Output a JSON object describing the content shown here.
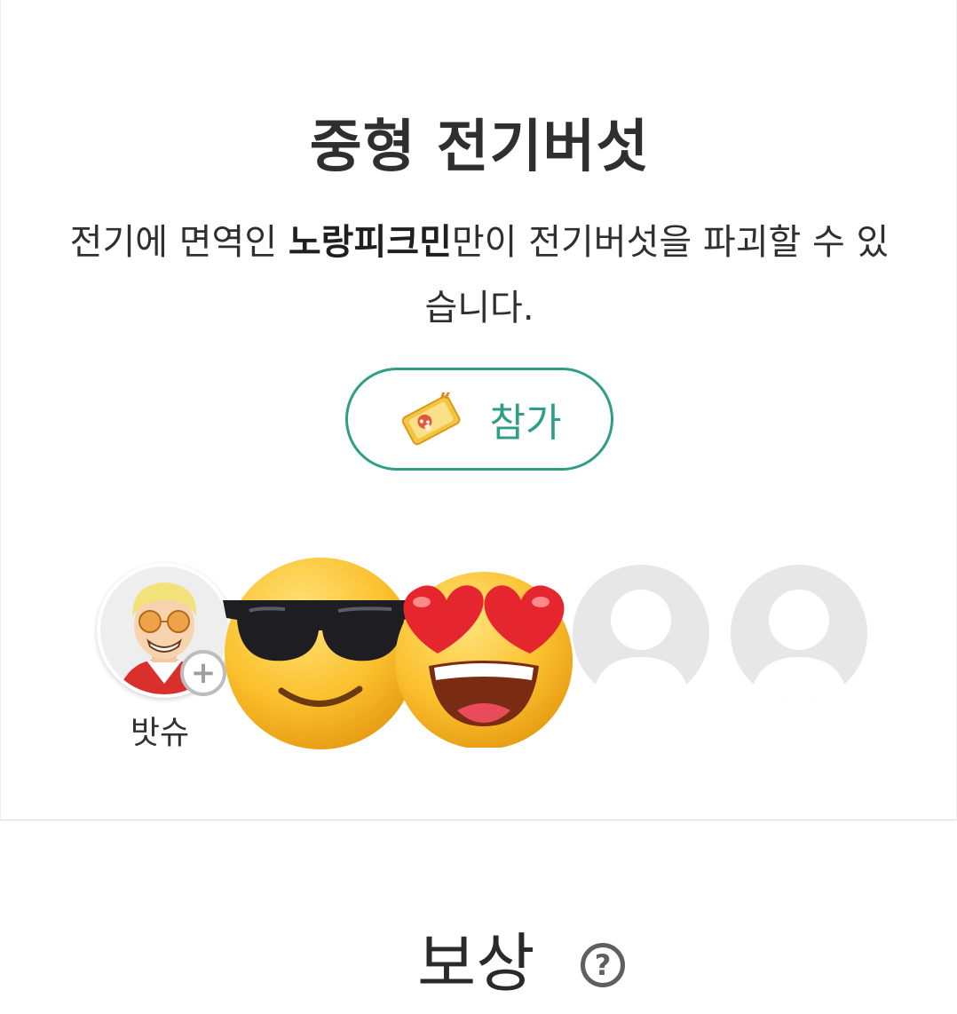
{
  "mission": {
    "title": "중형 전기버섯",
    "description_before": "전기에 면역인 ",
    "description_bold": "노랑피크민",
    "description_after": "만이 전기버섯을 파괴할 수 있습니다.",
    "join_button_label": "참가",
    "join_icon": "ticket-icon"
  },
  "party": {
    "members": [
      {
        "name": "밧슈",
        "avatar": "player-avatar"
      },
      {
        "avatar": "sunglasses-emoji"
      },
      {
        "avatar": "heart-eyes-emoji"
      }
    ],
    "empty_slots": 2,
    "add_badge_label": "+"
  },
  "rewards": {
    "title": "보상",
    "help_icon_label": "?"
  },
  "colors": {
    "accent": "#2f9e87",
    "empty_slot": "#e7e7e7",
    "divider": "#dcdcdc"
  }
}
